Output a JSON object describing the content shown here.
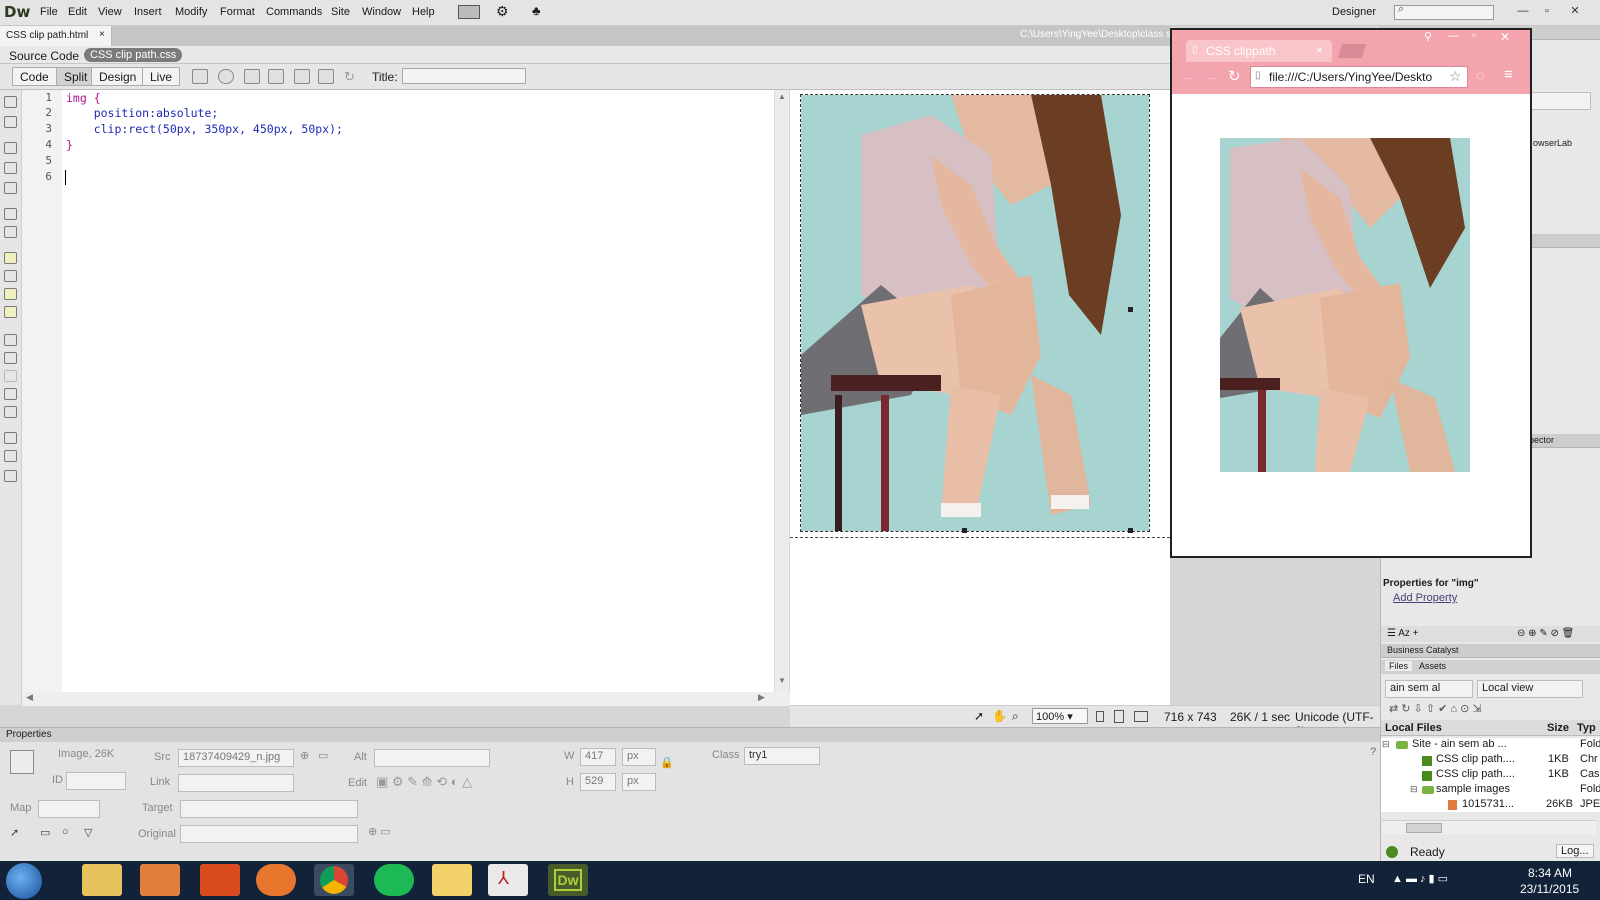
{
  "app": {
    "logo": "Dw",
    "workspace": "Designer"
  },
  "menu": [
    "File",
    "Edit",
    "View",
    "Insert",
    "Modify",
    "Format",
    "Commands",
    "Site",
    "Window",
    "Help"
  ],
  "document": {
    "tab": "CSS clip path.html",
    "path": "C:\\Users\\YingYee\\Desktop\\class stu",
    "source_label": "Source Code",
    "related_file": "CSS clip path.css"
  },
  "toolbar": {
    "views": [
      "Code",
      "Split",
      "Design",
      "Live"
    ],
    "title_label": "Title:",
    "title_value": ""
  },
  "code": {
    "line_numbers": [
      "1",
      "2",
      "3",
      "4",
      "5",
      "6"
    ],
    "lines": [
      "img {",
      "    position:absolute;",
      "    clip:rect(50px, 350px, 450px, 50px);",
      "}",
      "",
      ""
    ]
  },
  "status": {
    "zoom": "100%",
    "dimensions": "716 x 743",
    "size_time": "26K / 1 sec",
    "encoding": "Unicode (UTF-8)"
  },
  "properties": {
    "panel_title": "Properties",
    "kind": "Image, 26K",
    "id_label": "ID",
    "src_label": "Src",
    "src_value": "18737409429_n.jpg",
    "link_label": "Link",
    "alt_label": "Alt",
    "edit_label": "Edit",
    "w_label": "W",
    "w_value": "417",
    "h_label": "H",
    "h_value": "529",
    "unit": "px",
    "class_label": "Class",
    "class_value": "try1",
    "map_label": "Map",
    "target_label": "Target",
    "original_label": "Original"
  },
  "browser": {
    "tab_title": "CSS clippath",
    "url": "file:///C:/Users/YingYee/Deskto"
  },
  "right_panel": {
    "browserlab": "owserLab",
    "inspector": "pector",
    "props_for": "Properties for \"img\"",
    "add_property": "Add Property",
    "business_catalyst": "Business Catalyst",
    "files_tab": "Files",
    "assets_tab": "Assets",
    "site_select": "ain sem al",
    "view_select": "Local view",
    "cols": {
      "name": "Local Files",
      "size": "Size",
      "type": "Typ"
    },
    "files": [
      {
        "name": "Site - ain sem ab ...",
        "size": "",
        "type": "Fold"
      },
      {
        "name": "CSS clip path....",
        "size": "1KB",
        "type": "Chr"
      },
      {
        "name": "CSS clip path....",
        "size": "1KB",
        "type": "Cas"
      },
      {
        "name": "sample images",
        "size": "",
        "type": "Fold"
      },
      {
        "name": "1015731...",
        "size": "26KB",
        "type": "JPE"
      }
    ],
    "status": "Ready",
    "log_button": "Log..."
  },
  "taskbar": {
    "lang": "EN",
    "time": "8:34 AM",
    "date": "23/11/2015",
    "dw_label": "Dw"
  },
  "colors": {
    "accent": "#4a8a1e",
    "browser_chrome": "#f4a4ad",
    "taskbar": "#122238",
    "photo_bg": "#a7d3d1"
  }
}
